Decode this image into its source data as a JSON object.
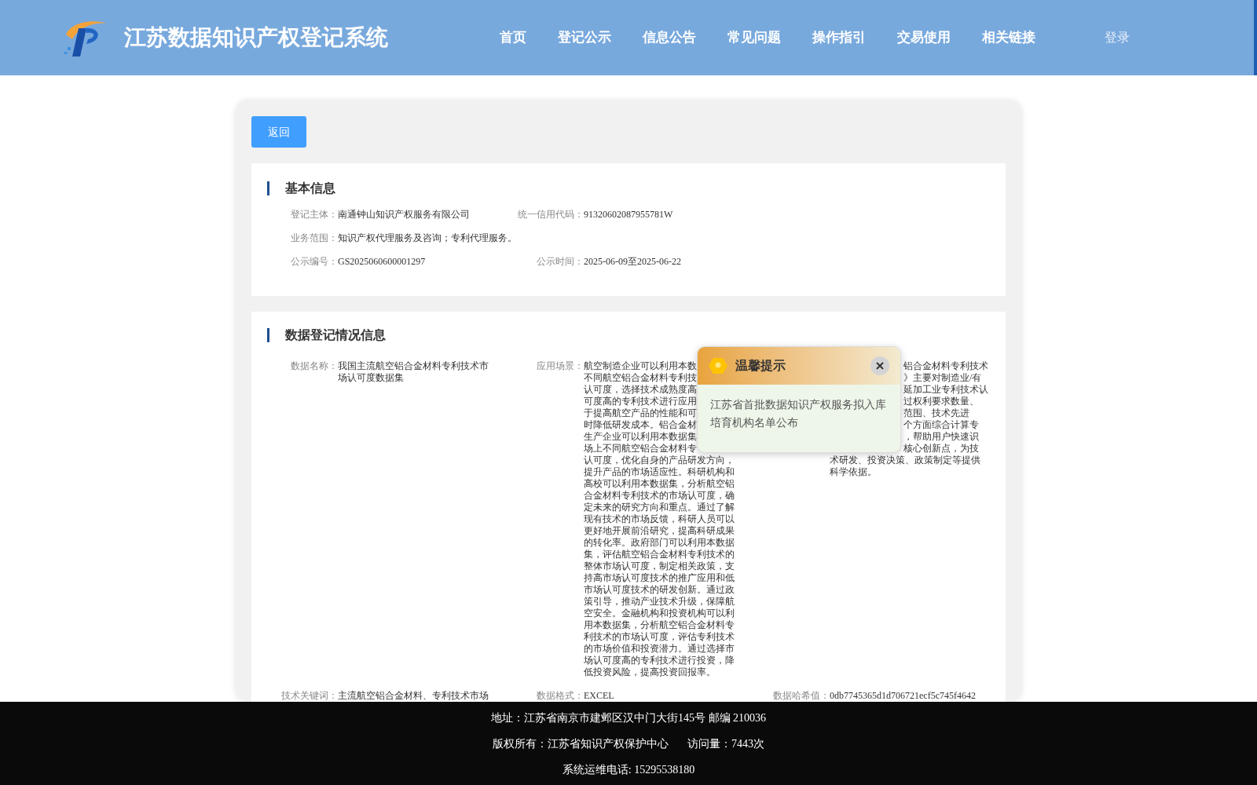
{
  "header": {
    "title": "江苏数据知识产权登记系统",
    "nav": [
      {
        "label": "首页",
        "selected": false
      },
      {
        "label": "登记公示",
        "selected": false
      },
      {
        "label": "信息公告",
        "selected": false
      },
      {
        "label": "常见问题",
        "selected": false
      },
      {
        "label": "操作指引",
        "selected": false
      },
      {
        "label": "交易使用",
        "selected": false
      },
      {
        "label": "相关链接",
        "selected": false
      }
    ],
    "login": "登录"
  },
  "back_button": "返回",
  "basic_info": {
    "title": "基本信息",
    "rows": [
      [
        {
          "label": "登记主体：",
          "value": "南通钟山知识产权服务有限公司"
        },
        {
          "label": "统一信用代码：",
          "value": "91320602087955781W"
        }
      ],
      [
        {
          "label": "业务范围：",
          "value": "知识产权代理服务及咨询；专利代理服务。"
        }
      ],
      [
        {
          "label": "公示编号：",
          "value": "GS2025060600001297"
        },
        {
          "label": "公示时间：",
          "value": "2025-06-09至2025-06-22"
        }
      ]
    ]
  },
  "registration_info": {
    "title": "数据登记情况信息",
    "data_name": {
      "label": "数据名称：",
      "value": "我国主流航空铝合金材料专利技术市场认可度数据集"
    },
    "application": {
      "label": "应用场景：",
      "lines": [
        "航空制造企业可以利用本数",
        "不同航空铝合金材料专利技",
        "认可度，选择技术成熟度高",
        "可度高的专利技术进行应用",
        "于提高航空产品的性能和可",
        "时降低研发成本。铝合金材",
        "生产企业可以利用本数据集",
        "场上不同航空铝合金材料专",
        "认可度，优化自身的产品研发方向，",
        "提升产品的市场适应性。科研机构和",
        "高校可以利用本数据集，分析航空铝",
        "合金材料专利技术的市场认可度，确",
        "定未来的研究方向和重点。通过了解",
        "现有技术的市场反馈，科研人员可以",
        "更好地开展前沿研究，提高科研成果",
        "的转化率。政府部门可以利用本数据",
        "集，评估航空铝合金材料专利技术的",
        "整体市场认可度，制定相关政策，支",
        "持高市场认可度技术的推广应用和低",
        "市场认可度技术的研发创新。通过政",
        "策引导，推动产业技术升级，保障航",
        "空安全。金融机构和投资机构可以利",
        "用本数据集，分析航空铝合金材料专",
        "利技术的市场认可度，评估专利技术",
        "的市场价值和投资潜力。通过选择市",
        "场认可度高的专利技术进行投资，降",
        "低投资风险，提高投资回报率。"
      ]
    },
    "description": {
      "lines": [
        {
          "kind": "partial",
          "text": "铝合金材料专利技术"
        },
        {
          "kind": "partial",
          "text": "》主要对制造业/有"
        },
        {
          "kind": "partial",
          "text": "延加工业专利技术认"
        },
        {
          "kind": "partial",
          "text": "过权利要求数量、"
        },
        {
          "kind": "partial",
          "text": "范围、技术先进"
        },
        {
          "kind": "partial",
          "text": "个方面综合计算专"
        },
        {
          "kind": "partial",
          "text": "，帮助用户快速识"
        },
        {
          "kind": "partial",
          "text": "核心创新点，为技"
        },
        {
          "kind": "full",
          "text": "术研发、投资决策、政策制定等提供"
        },
        {
          "kind": "full",
          "text": "科学依据。"
        }
      ]
    },
    "bottom_row": [
      {
        "label": "技术关键词：",
        "value": "主流航空铝合金材料、专利技术市场"
      },
      {
        "label": "数据格式：",
        "value": "EXCEL"
      },
      {
        "label": "数据哈希值：",
        "value": "0db7745365d1d706721ecf5c745f4642"
      }
    ]
  },
  "notice_popup": {
    "title": "温馨提示",
    "message": "江苏省首批数据知识产权服务拟入库培育机构名单公布"
  },
  "footer": {
    "lines": [
      [
        "地址：江苏省南京市建邺区汉中门大街145号 邮编 210036"
      ],
      [
        "版权所有：江苏省知识产权保护中心",
        "访问量：7443次"
      ],
      [
        "系统运维电话: 15295538180"
      ]
    ]
  }
}
